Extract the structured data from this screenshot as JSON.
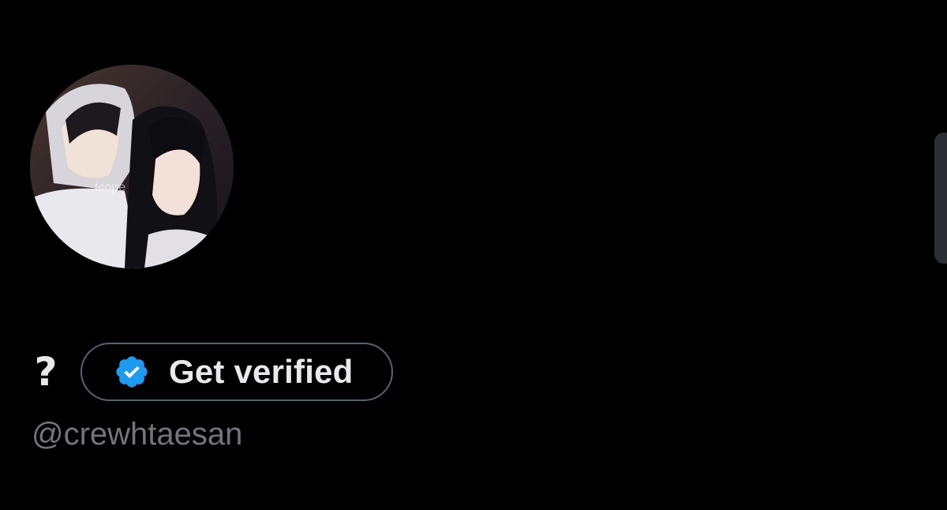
{
  "profile": {
    "avatar_icon": "profile-photo-avatar",
    "avatar_watermark": "tcope",
    "display_name": "?",
    "verify_button": {
      "label": "Get verified",
      "icon": "verified-badge-icon",
      "icon_color": "#1d9bf0"
    },
    "handle": "@crewhtaesan"
  },
  "colors": {
    "background": "#000000",
    "primary_text": "#e7e9ea",
    "secondary_text": "#71767b",
    "border": "#536471",
    "accent": "#1d9bf0"
  }
}
